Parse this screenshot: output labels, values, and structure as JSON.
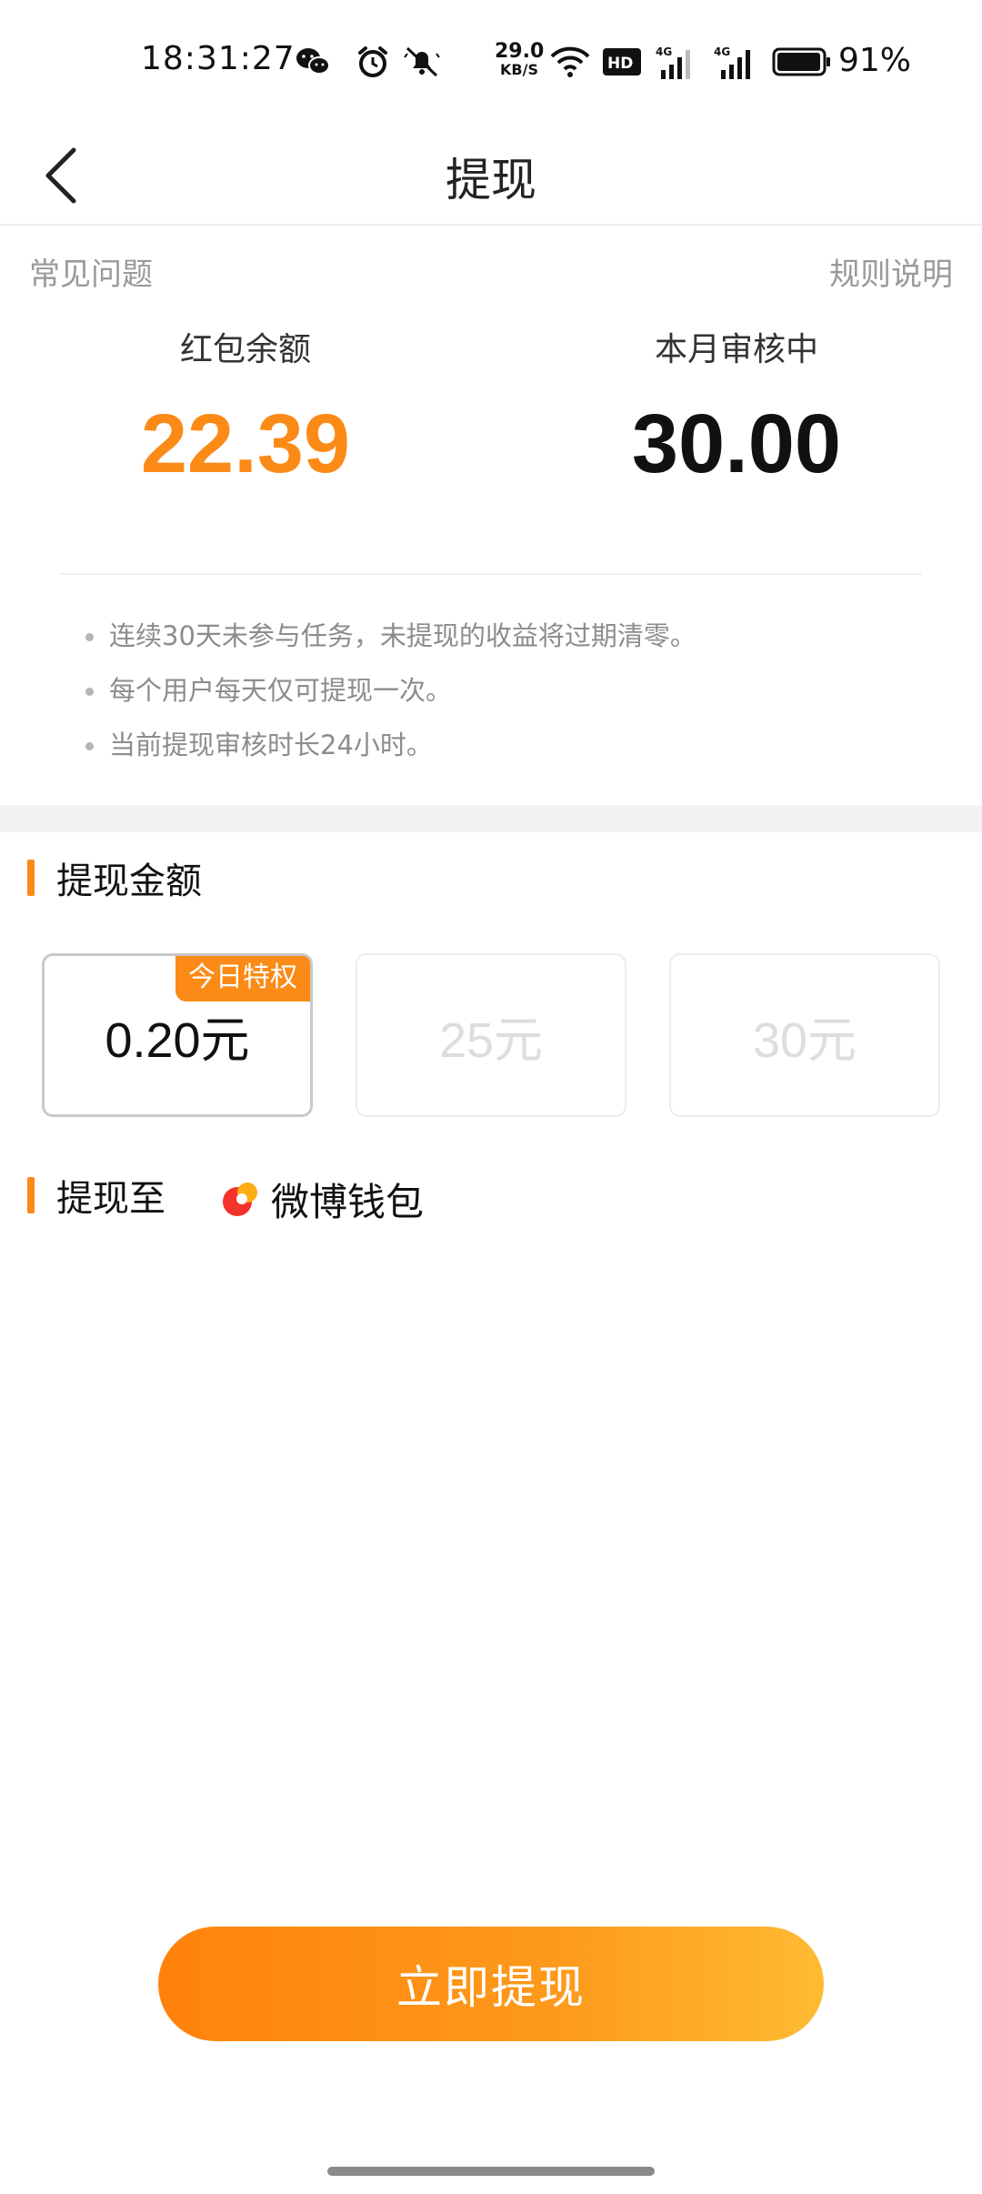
{
  "status_bar": {
    "time": "18:31:27",
    "net_speed_value": "29.0",
    "net_speed_unit": "KB/S",
    "battery_percent": "91%",
    "icons": [
      "wechat-icon",
      "alarm-icon",
      "mute-icon",
      "wifi-icon",
      "hd-icon",
      "signal-4g-icon",
      "signal-4g-icon",
      "battery-icon"
    ]
  },
  "nav": {
    "title": "提现",
    "back_icon": "chevron-left-icon"
  },
  "links": {
    "faq": "常见问题",
    "rules": "规则说明"
  },
  "balances": {
    "red_packet_label": "红包余额",
    "red_packet_value": "22.39",
    "reviewing_label": "本月审核中",
    "reviewing_value": "30.00"
  },
  "tips": [
    "连续30天未参与任务，未提现的收益将过期清零。",
    "每个用户每天仅可提现一次。",
    "当前提现审核时长24小时。"
  ],
  "amount_section": {
    "title": "提现金额",
    "options": [
      {
        "label": "0.20元",
        "badge": "今日特权",
        "state": "selected"
      },
      {
        "label": "25元",
        "state": "disabled"
      },
      {
        "label": "30元",
        "state": "disabled"
      }
    ]
  },
  "destination": {
    "title": "提现至",
    "wallet_label": "微博钱包",
    "wallet_icon": "weibo-wallet-icon"
  },
  "submit_button": "立即提现",
  "colors": {
    "accent": "#fb8a16",
    "text_gray": "#8c8c8c",
    "disabled": "#dddddd"
  }
}
